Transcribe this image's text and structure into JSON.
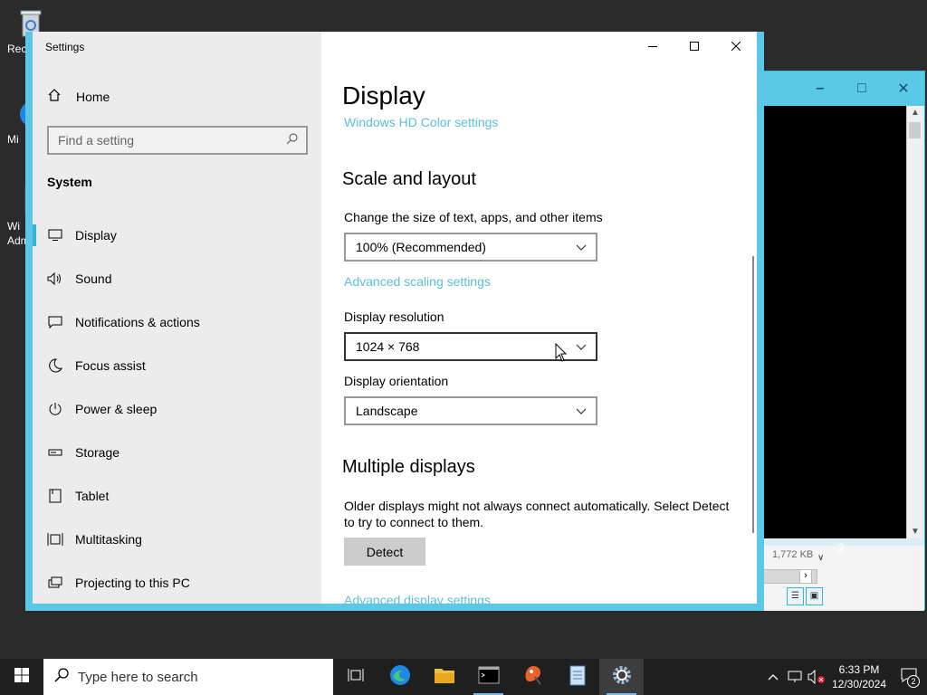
{
  "desktop": {
    "icons": [
      {
        "label": "Rec",
        "icon": "recycle-bin-icon"
      },
      {
        "label": "Mi",
        "icon": "edge-icon"
      },
      {
        "label": "Wi",
        "icon": "admin-tools-icon"
      },
      {
        "label": "Adm",
        "icon": "admin-tools-icon"
      }
    ]
  },
  "background_window": {
    "status_size": "1,772 KB",
    "fragment": "2"
  },
  "settings": {
    "title": "Settings",
    "sidebar": {
      "home_label": "Home",
      "search_placeholder": "Find a setting",
      "section_title": "System",
      "items": [
        {
          "label": "Display",
          "icon": "monitor-icon",
          "active": true
        },
        {
          "label": "Sound",
          "icon": "speaker-icon"
        },
        {
          "label": "Notifications & actions",
          "icon": "notification-icon"
        },
        {
          "label": "Focus assist",
          "icon": "moon-icon"
        },
        {
          "label": "Power & sleep",
          "icon": "power-icon"
        },
        {
          "label": "Storage",
          "icon": "storage-icon"
        },
        {
          "label": "Tablet",
          "icon": "tablet-icon"
        },
        {
          "label": "Multitasking",
          "icon": "multitasking-icon"
        },
        {
          "label": "Projecting to this PC",
          "icon": "projector-icon"
        }
      ]
    },
    "main": {
      "page_title": "Display",
      "hd_color_link": "Windows HD Color settings",
      "scale_heading": "Scale and layout",
      "scale_label": "Change the size of text, apps, and other items",
      "scale_value": "100% (Recommended)",
      "advanced_scaling_link": "Advanced scaling settings",
      "resolution_label": "Display resolution",
      "resolution_value": "1024 × 768",
      "orientation_label": "Display orientation",
      "orientation_value": "Landscape",
      "multiple_heading": "Multiple displays",
      "multiple_desc": "Older displays might not always connect automatically. Select Detect to try to connect to them.",
      "detect_label": "Detect",
      "advanced_display_link": "Advanced display settings"
    }
  },
  "taskbar": {
    "search_placeholder": "Type here to search",
    "apps": [
      "task-view-icon",
      "edge-icon",
      "file-explorer-icon",
      "command-prompt-icon",
      "paint-icon",
      "notepad-icon",
      "settings-icon"
    ],
    "time": "6:33 PM",
    "date": "12/30/2024",
    "notification_count": "2"
  },
  "colors": {
    "accent": "#39b3d7",
    "link": "#5bbede",
    "title_bar": "#5ac8e6"
  }
}
